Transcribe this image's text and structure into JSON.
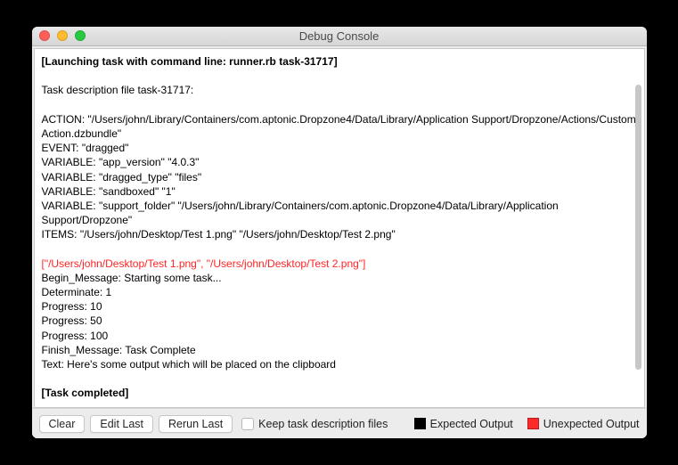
{
  "window": {
    "title": "Debug Console"
  },
  "console": {
    "launch_line": "[Launching task with command line: runner.rb task-31717]",
    "desc_header": "Task description file task-31717:",
    "action": "ACTION: \"/Users/john/Library/Containers/com.aptonic.Dropzone4/Data/Library/Application Support/Dropzone/Actions/Custom Action.dzbundle\"",
    "event": "EVENT: \"dragged\"",
    "var1": "VARIABLE: \"app_version\" \"4.0.3\"",
    "var2": "VARIABLE: \"dragged_type\" \"files\"",
    "var3": "VARIABLE: \"sandboxed\" \"1\"",
    "var4": "VARIABLE: \"support_folder\" \"/Users/john/Library/Containers/com.aptonic.Dropzone4/Data/Library/Application Support/Dropzone\"",
    "items": "ITEMS: \"/Users/john/Desktop/Test 1.png\" \"/Users/john/Desktop/Test 2.png\"",
    "unexpected": "[\"/Users/john/Desktop/Test 1.png\", \"/Users/john/Desktop/Test 2.png\"]",
    "begin": "Begin_Message: Starting some task...",
    "det": "Determinate: 1",
    "p10": "Progress: 10",
    "p50": "Progress: 50",
    "p100": "Progress: 100",
    "finish": "Finish_Message: Task Complete",
    "text_out": "Text: Here's some output which will be placed on the clipboard",
    "completed": "[Task completed]"
  },
  "toolbar": {
    "clear": "Clear",
    "edit_last": "Edit Last",
    "rerun_last": "Rerun Last",
    "keep_files": "Keep task description files",
    "legend_expected": "Expected Output",
    "legend_unexpected": "Unexpected Output"
  }
}
